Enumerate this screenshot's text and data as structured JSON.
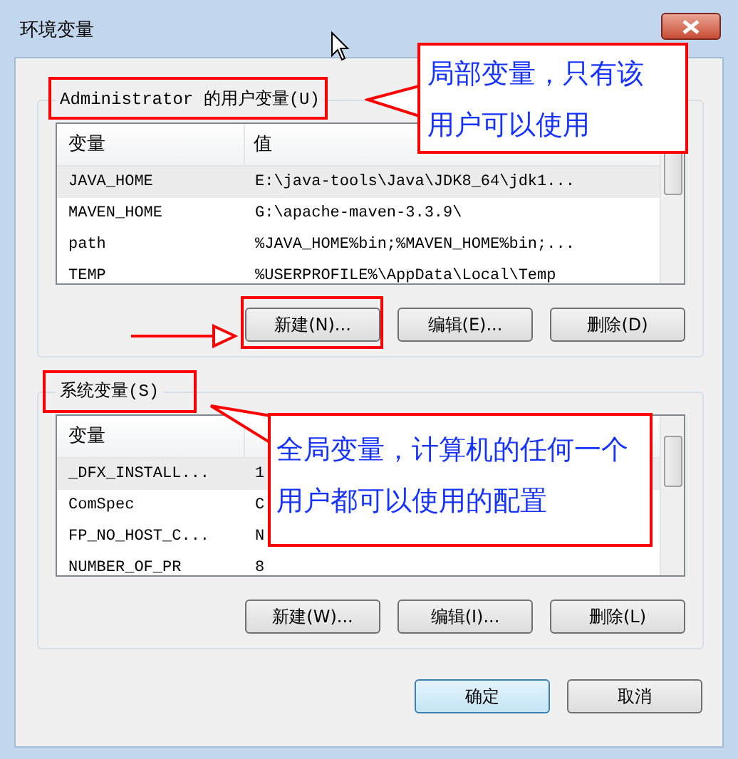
{
  "window": {
    "title": "环境变量"
  },
  "user_vars": {
    "label": "Administrator 的用户变量(U)",
    "label_highlighted": true,
    "columns": [
      "变量",
      "值"
    ],
    "rows": [
      {
        "name": "JAVA_HOME",
        "value": "E:\\java-tools\\Java\\JDK8_64\\jdk1...",
        "selected": true
      },
      {
        "name": "MAVEN_HOME",
        "value": "G:\\apache-maven-3.3.9\\",
        "selected": false
      },
      {
        "name": "path",
        "value": "%JAVA_HOME%bin;%MAVEN_HOME%bin;...",
        "selected": false
      },
      {
        "name": "TEMP",
        "value": "%USERPROFILE%\\AppData\\Local\\Temp",
        "selected": false
      }
    ],
    "buttons": [
      {
        "label": "新建(N)...",
        "highlighted": true
      },
      {
        "label": "编辑(E)...",
        "highlighted": false
      },
      {
        "label": "删除(D)",
        "highlighted": false
      }
    ]
  },
  "system_vars": {
    "label": "系统变量(S)",
    "label_highlighted": true,
    "columns": [
      "变量"
    ],
    "rows": [
      {
        "name": "_DFX_INSTALL...",
        "value": "1",
        "selected": true
      },
      {
        "name": "ComSpec",
        "value": "C",
        "selected": false
      },
      {
        "name": "FP_NO_HOST_C...",
        "value": "N",
        "selected": false
      },
      {
        "name": "NUMBER_OF_PR",
        "value": "8",
        "selected": false
      }
    ],
    "buttons": [
      {
        "label": "新建(W)...",
        "highlighted": false
      },
      {
        "label": "编辑(I)...",
        "highlighted": false
      },
      {
        "label": "删除(L)",
        "highlighted": false
      }
    ]
  },
  "footer_buttons": [
    {
      "label": "确定",
      "default": true
    },
    {
      "label": "取消",
      "default": false
    }
  ],
  "annotations": [
    {
      "text": "局部变量，只有该用户可以使用"
    },
    {
      "text": "全局变量，计算机的任何一个用户都可以使用的配置"
    }
  ]
}
